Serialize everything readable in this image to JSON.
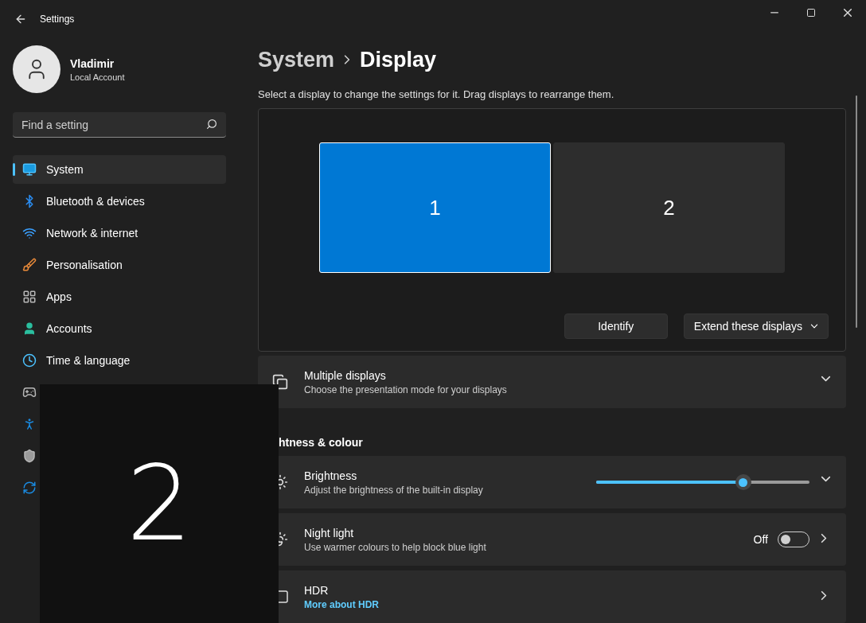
{
  "window": {
    "title": "Settings"
  },
  "account": {
    "name": "Vladimir",
    "type": "Local Account"
  },
  "search": {
    "placeholder": "Find a setting"
  },
  "sidebar": {
    "items": [
      {
        "kind": "system",
        "label": "System",
        "selected": true
      },
      {
        "kind": "bluetooth",
        "label": "Bluetooth & devices",
        "selected": false
      },
      {
        "kind": "network",
        "label": "Network & internet",
        "selected": false
      },
      {
        "kind": "personalisation",
        "label": "Personalisation",
        "selected": false
      },
      {
        "kind": "apps",
        "label": "Apps",
        "selected": false
      },
      {
        "kind": "accounts",
        "label": "Accounts",
        "selected": false
      },
      {
        "kind": "time",
        "label": "Time & language",
        "selected": false
      },
      {
        "kind": "gaming",
        "selected": false
      },
      {
        "kind": "accessibility",
        "selected": false
      },
      {
        "kind": "privacy",
        "selected": false
      },
      {
        "kind": "update",
        "selected": false
      }
    ]
  },
  "breadcrumb": [
    "System",
    "Display"
  ],
  "description": "Select a display to change the settings for it. Drag displays to rearrange them.",
  "displays": [
    {
      "label": "1",
      "selected": true
    },
    {
      "label": "2",
      "selected": false
    }
  ],
  "display_buttons": [
    {
      "kind": "button",
      "label": "Identify"
    },
    {
      "kind": "dropdown",
      "label": "Extend these displays"
    }
  ],
  "multiple_displays": {
    "title": "Multiple displays",
    "subtitle": "Choose the presentation mode for your displays",
    "expanded": false
  },
  "section_heading": "htness & colour",
  "settings": [
    {
      "kind": "slider",
      "title": "Brightness",
      "subtitle": "Adjust the brightness of the built-in display",
      "level": 0.69
    },
    {
      "kind": "toggle",
      "title": "Night light",
      "subtitle": "Use warmer colours to help block blue light",
      "state_label": "Off",
      "on": false
    },
    {
      "kind": "link",
      "title": "HDR",
      "link": "More about HDR"
    }
  ],
  "identify_overlay": {
    "label": "2"
  }
}
